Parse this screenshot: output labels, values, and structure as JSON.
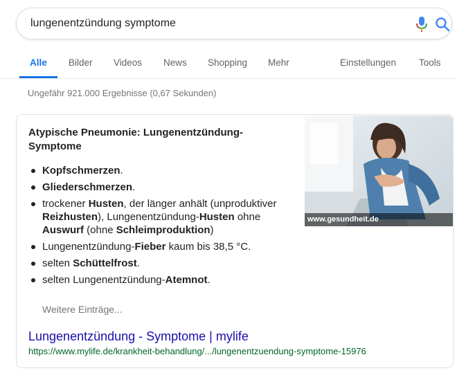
{
  "search": {
    "query": "lungenentzündung symptome"
  },
  "icons": {
    "mic": "mic-icon",
    "search": "search-icon"
  },
  "colors": {
    "accent": "#1a73e8",
    "link": "#1a0dab",
    "url": "#006621",
    "muted": "#70757a"
  },
  "tabs": [
    {
      "label": "Alle",
      "active": true
    },
    {
      "label": "Bilder"
    },
    {
      "label": "Videos"
    },
    {
      "label": "News"
    },
    {
      "label": "Shopping"
    },
    {
      "label": "Mehr"
    },
    {
      "label": "Einstellungen"
    },
    {
      "label": "Tools"
    }
  ],
  "result_stats": "Ungefähr 921.000 Ergebnisse (0,67 Sekunden)",
  "snippet": {
    "title": "Atypische Pneumonie: Lungenentzündung-Symptome",
    "items": [
      [
        {
          "t": "Kopfschmerzen",
          "b": true
        },
        {
          "t": "."
        }
      ],
      [
        {
          "t": "Gliederschmerzen",
          "b": true
        },
        {
          "t": "."
        }
      ],
      [
        {
          "t": "trockener "
        },
        {
          "t": "Husten",
          "b": true
        },
        {
          "t": ", der länger anhält (unproduktiver "
        },
        {
          "t": "Reizhusten",
          "b": true
        },
        {
          "t": "), Lungenentzündung-"
        },
        {
          "t": "Husten",
          "b": true
        },
        {
          "t": " ohne "
        },
        {
          "t": "Auswurf",
          "b": true
        },
        {
          "t": " (ohne "
        },
        {
          "t": "Schleimproduktion",
          "b": true
        },
        {
          "t": ")"
        }
      ],
      [
        {
          "t": "Lungenentzündung-"
        },
        {
          "t": "Fieber",
          "b": true
        },
        {
          "t": " kaum bis 38,5 °C."
        }
      ],
      [
        {
          "t": "selten "
        },
        {
          "t": "Schüttelfrost",
          "b": true
        },
        {
          "t": "."
        }
      ],
      [
        {
          "t": "selten Lungenentzündung-"
        },
        {
          "t": "Atemnot",
          "b": true
        },
        {
          "t": "."
        }
      ]
    ],
    "more_label": "Weitere Einträge...",
    "image_caption": "www.gesundheit.de"
  },
  "result": {
    "title": "Lungenentzündung - Symptome | mylife",
    "url": "https://www.mylife.de/krankheit-behandlung/.../lungenentzuendung-symptome-15976"
  }
}
